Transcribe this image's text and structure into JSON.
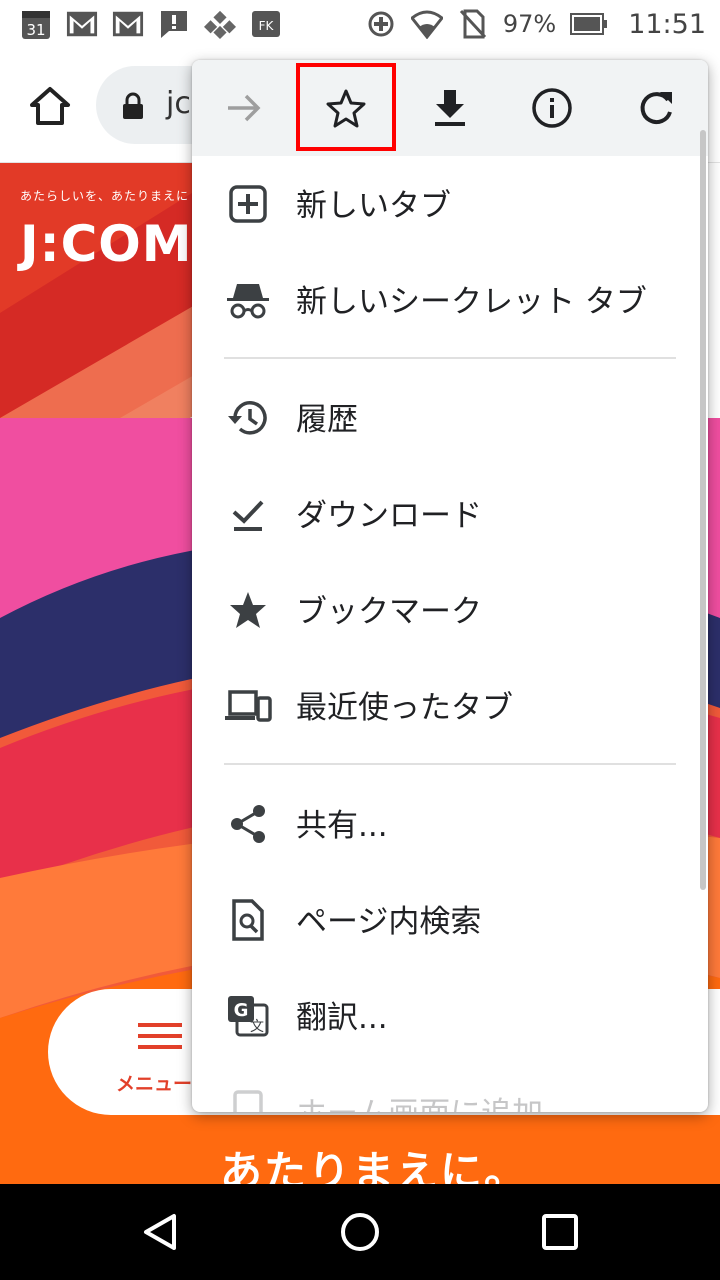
{
  "status_bar": {
    "calendar_day": "31",
    "battery": "97%",
    "time": "11:51",
    "icons": [
      "calendar-icon",
      "gmail-icon",
      "gmail-icon",
      "alert-icon",
      "app-icon",
      "app-icon",
      "data-saver-icon",
      "wifi-icon",
      "no-sim-icon",
      "battery-icon"
    ]
  },
  "toolbar": {
    "url": "jc"
  },
  "page": {
    "tagline": "あたらしいを、あたりまえに",
    "logo": "J:COM",
    "menu_label": "メニュー",
    "headline": "あたりまえに。",
    "colors": {
      "brand_red": "#e8452d"
    }
  },
  "menu": {
    "top_actions": [
      "forward-icon",
      "bookmark-star-icon",
      "download-icon",
      "info-icon",
      "refresh-icon"
    ],
    "highlighted": "bookmark-star-icon",
    "items": [
      {
        "label": "新しいタブ",
        "icon": "new-tab-icon"
      },
      {
        "label": "新しいシークレット タブ",
        "icon": "incognito-icon"
      },
      {
        "label": "履歴",
        "icon": "history-icon"
      },
      {
        "label": "ダウンロード",
        "icon": "downloads-icon"
      },
      {
        "label": "ブックマーク",
        "icon": "bookmarks-star-icon"
      },
      {
        "label": "最近使ったタブ",
        "icon": "recent-tabs-icon"
      },
      {
        "label": "共有...",
        "icon": "share-icon"
      },
      {
        "label": "ページ内検索",
        "icon": "find-in-page-icon"
      },
      {
        "label": "翻訳...",
        "icon": "translate-icon"
      },
      {
        "label": "ホーム画面に追加",
        "icon": "add-to-home-icon"
      }
    ]
  }
}
